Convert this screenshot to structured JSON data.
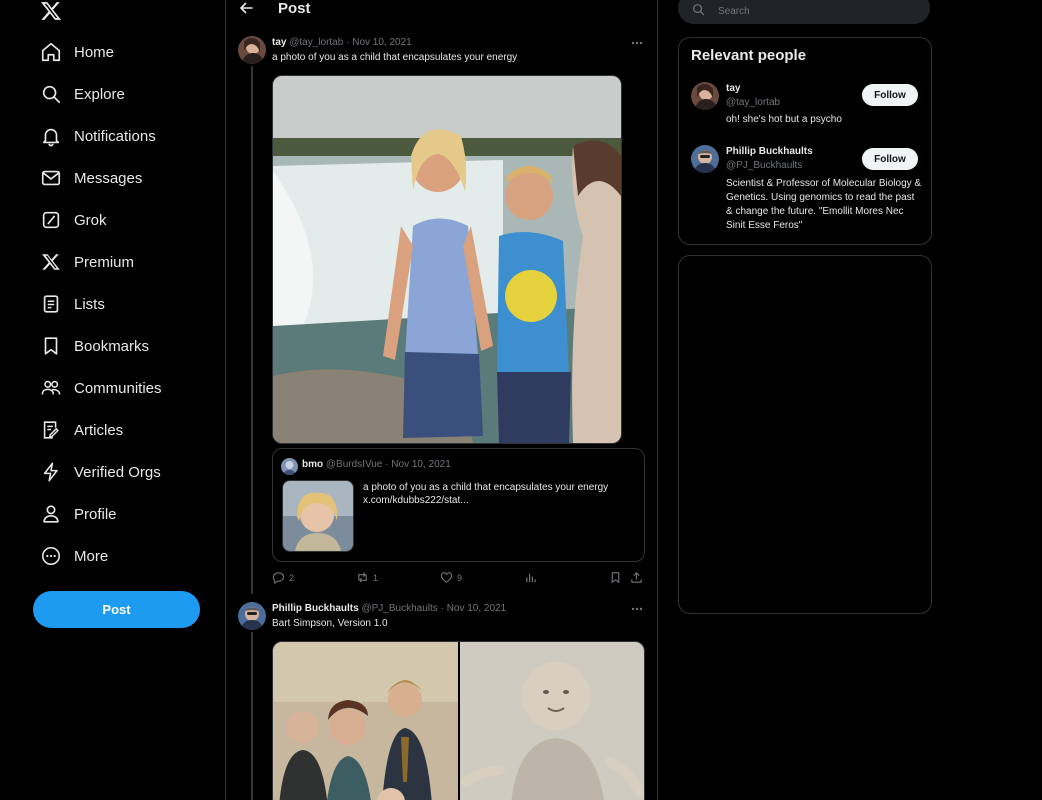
{
  "nav": {
    "items": [
      {
        "label": "Home",
        "icon": "home-icon"
      },
      {
        "label": "Explore",
        "icon": "search-icon"
      },
      {
        "label": "Notifications",
        "icon": "bell-icon"
      },
      {
        "label": "Messages",
        "icon": "envelope-icon"
      },
      {
        "label": "Grok",
        "icon": "grok-icon"
      },
      {
        "label": "Premium",
        "icon": "x-icon"
      },
      {
        "label": "Lists",
        "icon": "list-icon"
      },
      {
        "label": "Bookmarks",
        "icon": "bookmark-icon"
      },
      {
        "label": "Communities",
        "icon": "people-icon"
      },
      {
        "label": "Articles",
        "icon": "article-icon"
      },
      {
        "label": "Verified Orgs",
        "icon": "lightning-icon"
      },
      {
        "label": "Profile",
        "icon": "person-icon"
      },
      {
        "label": "More",
        "icon": "more-circle-icon"
      }
    ],
    "post_button": "Post"
  },
  "header": {
    "title": "Post"
  },
  "tweets": [
    {
      "name": "tay",
      "handle": "@tay_lortab",
      "date": "Nov 10, 2021",
      "text": "a photo of you as a child that encapsulates your energy",
      "quote": {
        "name": "bmo",
        "handle": "@BurdsIVue",
        "date": "Nov 10, 2021",
        "text": "a photo of you as a child that encapsulates your energy",
        "link": "x.com/kdubbs222/stat..."
      },
      "actions": {
        "replies": "2",
        "reposts": "1",
        "likes": "9"
      }
    },
    {
      "name": "Phillip Buckhaults",
      "handle": "@PJ_Buckhaults",
      "date": "Nov 10, 2021",
      "text": "Bart Simpson, Version 1.0"
    }
  ],
  "search": {
    "placeholder": "Search"
  },
  "relevant": {
    "title": "Relevant people",
    "people": [
      {
        "name": "tay",
        "handle": "@tay_lortab",
        "bio": "oh! she's hot but a psycho",
        "follow": "Follow"
      },
      {
        "name": "Phillip Buckhaults",
        "handle": "@PJ_Buckhaults",
        "bio": "Scientist & Professor of Molecular Biology & Genetics. Using genomics to read the past & change the future. \"Emollit Mores Nec Sinit Esse Feros\"",
        "follow": "Follow"
      }
    ]
  },
  "colors": {
    "accent": "#1d9bf0",
    "background": "#000000",
    "border": "#2f3336",
    "muted": "#71767b"
  }
}
